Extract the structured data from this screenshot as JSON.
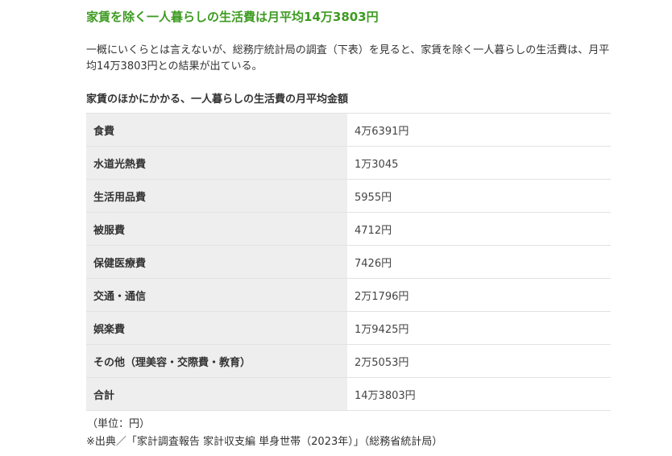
{
  "section": {
    "heading": "家賃を除く一人暮らしの生活費は月平均14万3803円",
    "paragraph": "一概にいくらとは言えないが、総務庁統計局の調査（下表）を見ると、家賃を除く一人暮らしの生活費は、月平均14万3803円との結果が出ている。"
  },
  "table": {
    "title": "家賃のほかにかかる、一人暮らしの生活費の月平均金額",
    "rows": [
      {
        "label": "食費",
        "value": "4万6391円"
      },
      {
        "label": "水道光熱費",
        "value": "1万3045"
      },
      {
        "label": "生活用品費",
        "value": "5955円"
      },
      {
        "label": "被服費",
        "value": "4712円"
      },
      {
        "label": "保健医療費",
        "value": "7426円"
      },
      {
        "label": "交通・通信",
        "value": "2万1796円"
      },
      {
        "label": "娯楽費",
        "value": "1万9425円"
      },
      {
        "label": "その他（理美容・交際費・教育）",
        "value": "2万5053円"
      },
      {
        "label": "合計",
        "value": "14万3803円"
      }
    ]
  },
  "notes": {
    "unit": "（単位：円）",
    "source": "※出典／「家計調査報告 家計収支編 単身世帯（2023年）」（総務省統計局）"
  },
  "colors": {
    "heading_green": "#3e9b22",
    "label_cell_bg": "#eeeeee",
    "text": "#333333"
  }
}
